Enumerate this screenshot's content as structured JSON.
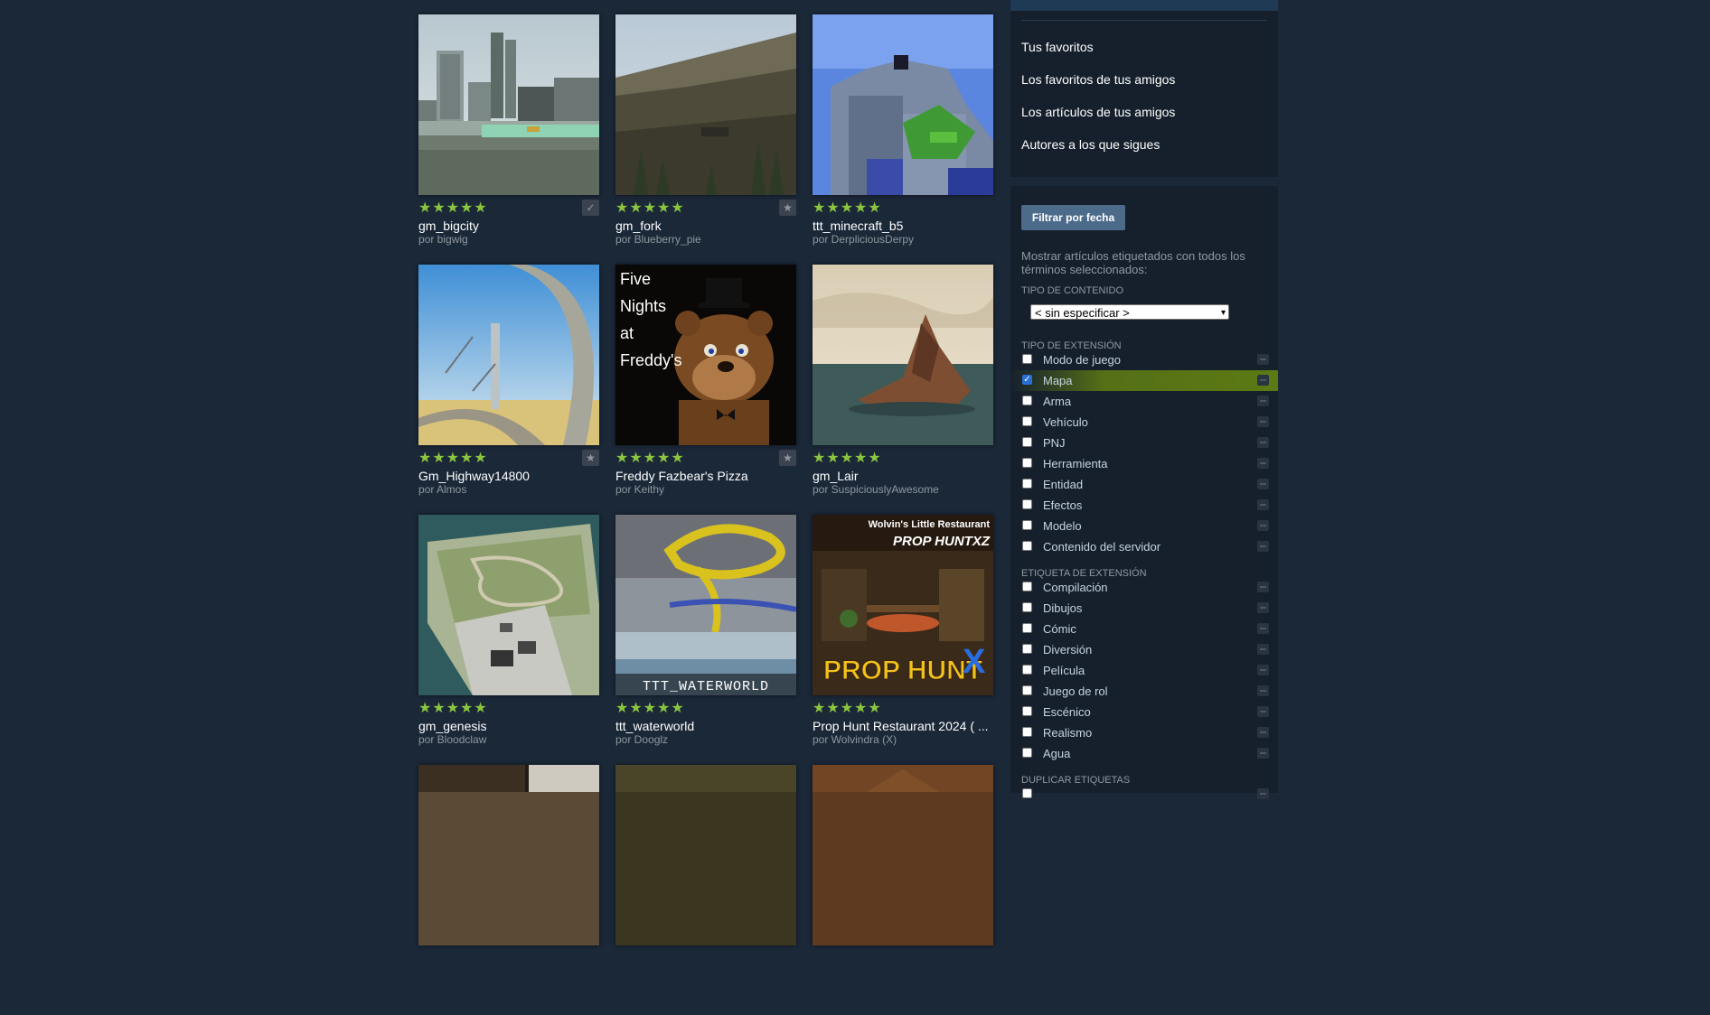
{
  "items": [
    {
      "title": "gm_bigcity",
      "author": "por bigwig",
      "rating": "★★★★★",
      "fav": "✓"
    },
    {
      "title": "gm_fork",
      "author": "por Blueberry_pie",
      "rating": "★★★★★",
      "fav": "★"
    },
    {
      "title": "ttt_minecraft_b5",
      "author": "por DerpliciousDerpy",
      "rating": "★★★★★",
      "fav": ""
    },
    {
      "title": "Gm_Highway14800",
      "author": "por Almos",
      "rating": "★★★★★",
      "fav": "★"
    },
    {
      "title": "Freddy Fazbear's Pizza",
      "author": "por Keithy",
      "rating": "★★★★★",
      "fav": "★"
    },
    {
      "title": "gm_Lair",
      "author": "por SuspiciouslyAwesome",
      "rating": "★★★★★",
      "fav": ""
    },
    {
      "title": "gm_genesis",
      "author": "por Bloodclaw",
      "rating": "★★★★★",
      "fav": ""
    },
    {
      "title": "ttt_waterworld",
      "author": "por Dooglz",
      "rating": "★★★★★",
      "fav": ""
    },
    {
      "title": "Prop Hunt Restaurant 2024 ( ...",
      "author": "por Wolvindra (X)",
      "rating": "★★★★★",
      "fav": ""
    }
  ],
  "thumb_text": {
    "fnaf": [
      "Five",
      "Nights",
      "at",
      "Freddy's"
    ],
    "waterworld": "TTT_WATERWORLD",
    "prophunt_top": "Wolvin's Little Restaurant",
    "prophunt_logo": "PROP HUNTXZ",
    "prophunt_big": "PROP HUNT"
  },
  "sidebar": {
    "links": [
      "Tus favoritos",
      "Los favoritos de tus amigos",
      "Los artículos de tus amigos",
      "Autores a los que sigues"
    ],
    "filter_button": "Filtrar por fecha",
    "description": "Mostrar artículos etiquetados con todos los términos seleccionados:",
    "content_type_label": "TIPO DE CONTENIDO",
    "content_type_value": "< sin especificar >",
    "extension_type_label": "TIPO DE EXTENSIÓN",
    "extension_types": [
      {
        "label": "Modo de juego",
        "checked": false
      },
      {
        "label": "Mapa",
        "checked": true
      },
      {
        "label": "Arma",
        "checked": false
      },
      {
        "label": "Vehículo",
        "checked": false
      },
      {
        "label": "PNJ",
        "checked": false
      },
      {
        "label": "Herramienta",
        "checked": false
      },
      {
        "label": "Entidad",
        "checked": false
      },
      {
        "label": "Efectos",
        "checked": false
      },
      {
        "label": "Modelo",
        "checked": false
      },
      {
        "label": "Contenido del servidor",
        "checked": false
      }
    ],
    "extension_tag_label": "ETIQUETA DE EXTENSIÓN",
    "extension_tags": [
      {
        "label": "Compilación",
        "checked": false
      },
      {
        "label": "Dibujos",
        "checked": false
      },
      {
        "label": "Cómic",
        "checked": false
      },
      {
        "label": "Diversión",
        "checked": false
      },
      {
        "label": "Película",
        "checked": false
      },
      {
        "label": "Juego de rol",
        "checked": false
      },
      {
        "label": "Escénico",
        "checked": false
      },
      {
        "label": "Realismo",
        "checked": false
      },
      {
        "label": "Agua",
        "checked": false
      }
    ],
    "duplicate_tags_label": "DUPLICAR ETIQUETAS"
  },
  "colors": {
    "background": "#1b2838",
    "stars": "#8bc53f",
    "active_row": "#5c7a13",
    "button": "#4c6b8b"
  }
}
